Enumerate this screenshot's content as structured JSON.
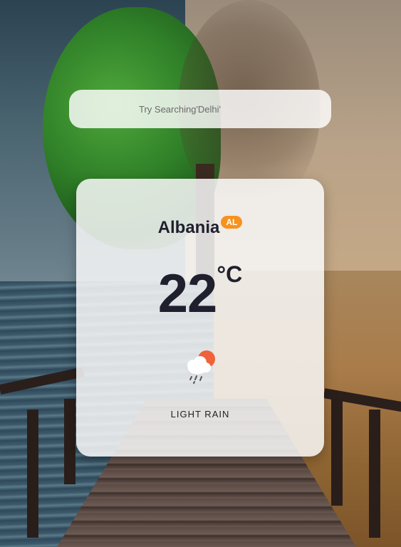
{
  "search": {
    "placeholder": "Try Searching'Delhi'"
  },
  "weather": {
    "city": "Albania",
    "country_code": "AL",
    "temperature": "22",
    "unit": "°C",
    "condition": "LIGHT RAIN",
    "icon": "sun-behind-rain-cloud-icon"
  },
  "colors": {
    "badge": "#f7921e",
    "text": "#1f1f2e",
    "sun": "#f0623a"
  }
}
